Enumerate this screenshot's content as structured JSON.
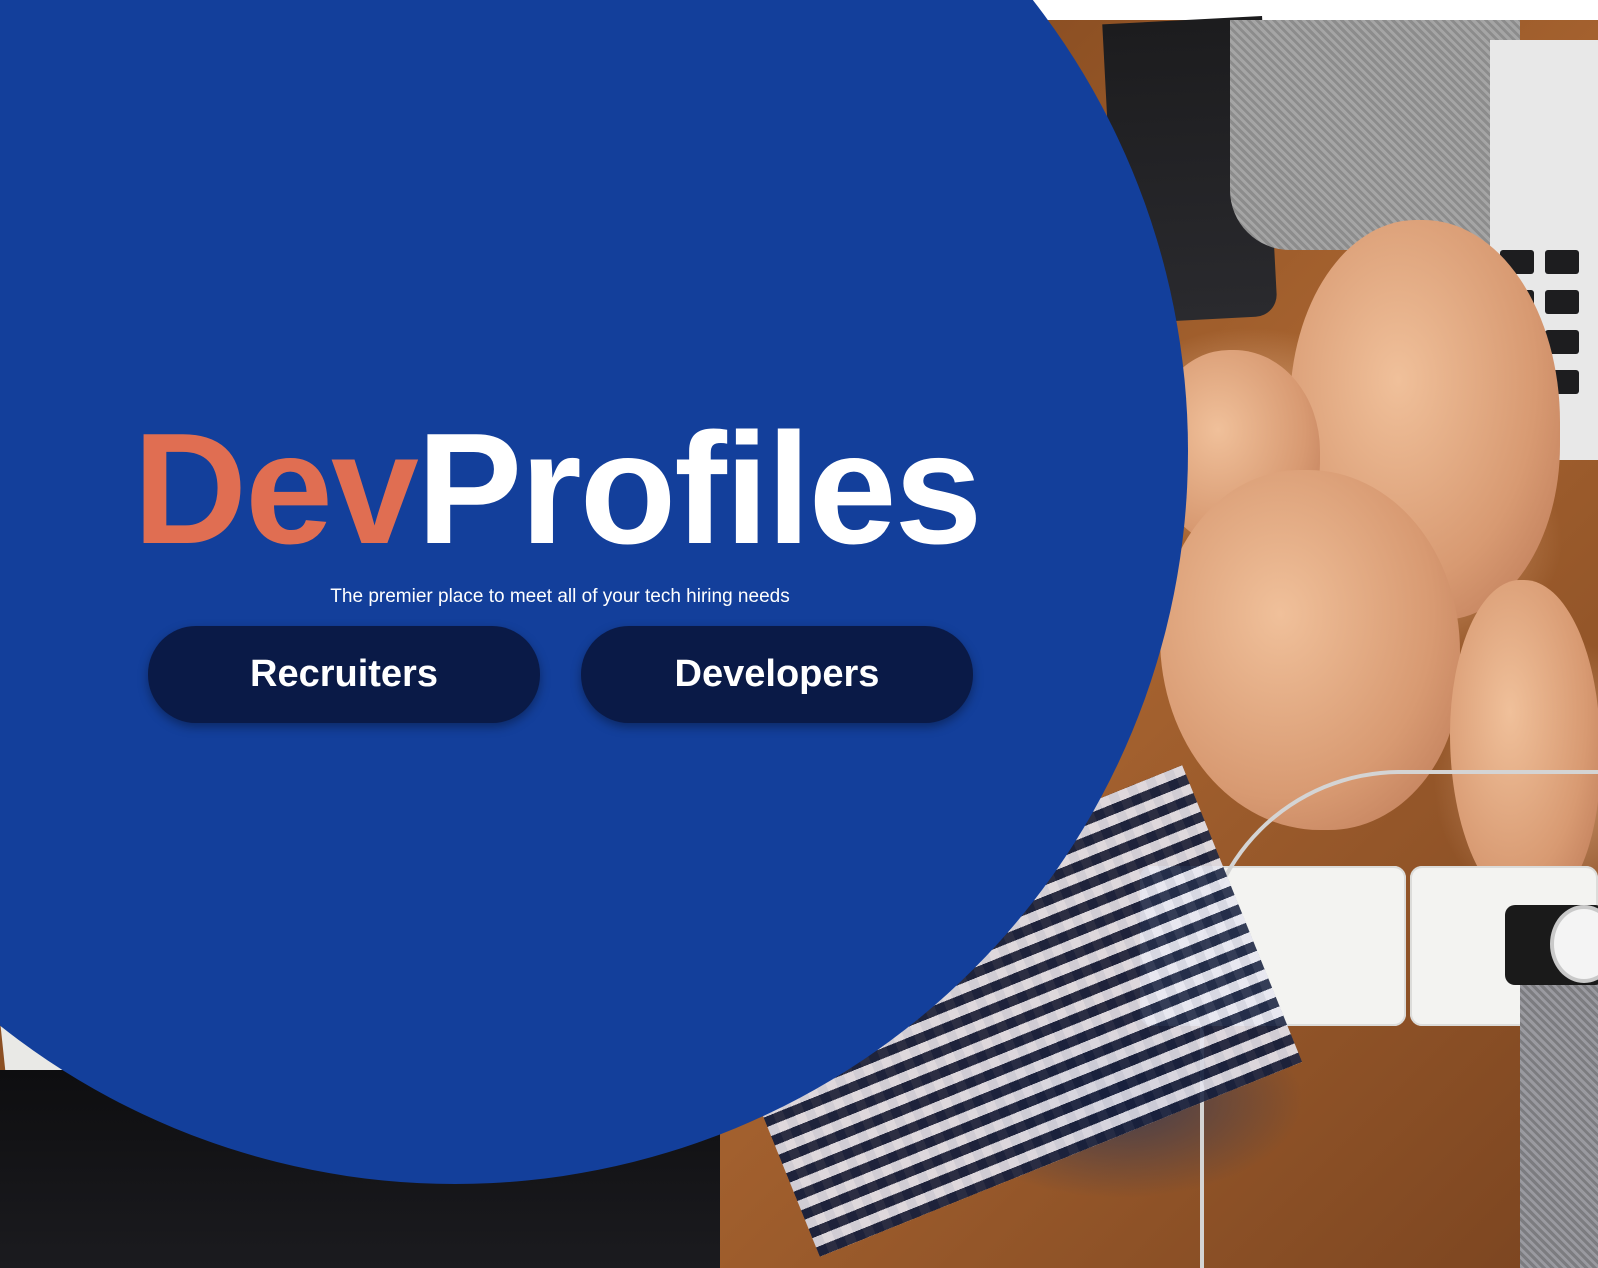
{
  "brand": {
    "part_one": "Dev",
    "part_two": "Profiles",
    "accent_color": "#e06e52",
    "primary_color": "#ffffff"
  },
  "hero": {
    "tagline": "The premier place to meet all of your tech hiring needs",
    "circle_color": "#133f9b",
    "background_image": "team-fist-bump-photo"
  },
  "cta": {
    "recruiters_label": "Recruiters",
    "developers_label": "Developers",
    "button_color": "#0a1a47"
  }
}
